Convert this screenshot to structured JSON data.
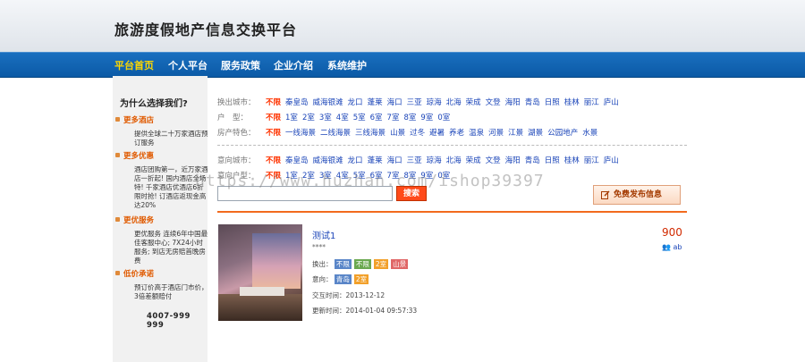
{
  "header": {
    "title": "旅游度假地产信息交换平台"
  },
  "nav": {
    "items": [
      "平台首页",
      "个人平台",
      "服务政策",
      "企业介绍",
      "系统维护"
    ]
  },
  "sidebar": {
    "title": "为什么选择我们?",
    "sections": [
      {
        "heading": "更多酒店",
        "text": "提供全球二十万家酒店预订服务"
      },
      {
        "heading": "更多优惠",
        "text": "酒店团购第一，近万家酒店一折起! 国内酒店全场特! 千家酒店优酒店6折限时抢! 订酒店返现金高达20%"
      },
      {
        "heading": "更优服务",
        "text": "更优服务 连续6年中国最佳客服中心; 7X24小时服务; 到店无房赔首晚房费"
      },
      {
        "heading": "低价承诺",
        "text": "预订价高于酒店门市价，3倍差额赔付"
      }
    ],
    "phone": "4007-999 999"
  },
  "filters": {
    "row1": {
      "label": "换出城市：",
      "options": [
        "不限",
        "秦皇岛",
        "威海银滩",
        "龙口",
        "蓬莱",
        "海口",
        "三亚",
        "琼海",
        "北海",
        "荣成",
        "文登",
        "海阳",
        "青岛",
        "日照",
        "桂林",
        "丽江",
        "庐山"
      ]
    },
    "row2": {
      "label": "户　型：",
      "options": [
        "不限",
        "1室",
        "2室",
        "3室",
        "4室",
        "5室",
        "6室",
        "7室",
        "8室",
        "9室",
        "0室"
      ]
    },
    "row3": {
      "label": "房产特色：",
      "options": [
        "不限",
        "一线海景",
        "二线海景",
        "三线海景",
        "山景",
        "过冬",
        "避暑",
        "养老",
        "温泉",
        "河景",
        "江景",
        "湖景",
        "公园地产",
        "水景"
      ]
    },
    "row4": {
      "label": "意向城市：",
      "options": [
        "不限",
        "秦皇岛",
        "威海银滩",
        "龙口",
        "蓬莱",
        "海口",
        "三亚",
        "琼海",
        "北海",
        "荣成",
        "文登",
        "海阳",
        "青岛",
        "日照",
        "桂林",
        "丽江",
        "庐山"
      ]
    },
    "row5": {
      "label": "意向户型：",
      "options": [
        "不限",
        "1室",
        "2室",
        "3室",
        "4室",
        "5室",
        "6室",
        "7室",
        "8室",
        "9室",
        "0室"
      ]
    }
  },
  "search": {
    "button": "搜索",
    "value": ""
  },
  "publish": {
    "label": "免费发布信息"
  },
  "listing": {
    "title": "测试1",
    "price": "900",
    "stars": "****",
    "people": "ab",
    "out_label": "换出：",
    "out_tags": [
      "不限",
      "不限",
      "2室",
      "山景"
    ],
    "want_label": "意向：",
    "want_tags": [
      "青岛",
      "2室"
    ],
    "exchange_label": "交互时间：",
    "exchange_time": "2013-12-12",
    "update_label": "更新时间：",
    "update_time": "2014-01-04 09:57:33"
  },
  "watermark": "https://www.huzhan.com/ishop39397",
  "colors": {
    "nav": "#0b5aa6",
    "accent": "#ff3300",
    "link": "#1a44b8",
    "orange": "#f26b1d"
  }
}
